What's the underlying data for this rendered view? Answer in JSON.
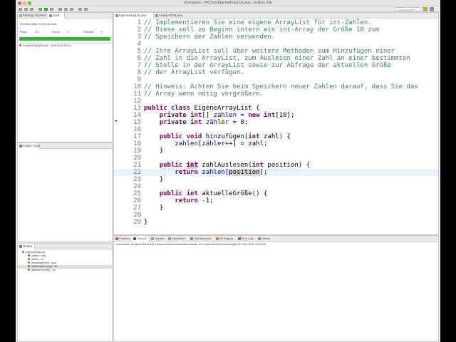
{
  "window": {
    "title": "workspace - PR1/src/EigeneArrayList.java - Eclipse IDE",
    "traffic_lights": [
      "#ee5f58",
      "#f6be4f",
      "#5fc454"
    ]
  },
  "toolbar": {
    "quick_access_placeholder": "Quick Access"
  },
  "left_pane": {
    "tabs": [
      {
        "label": "Package Explorer"
      },
      {
        "label": "JUnit",
        "active": true
      }
    ],
    "status": "Finished after 0.102 seconds",
    "counters": {
      "runs_label": "Runs:",
      "runs_value": "1/1",
      "errors_label": "Errors:",
      "errors_value": "0",
      "failures_label": "Failures:",
      "failures_value": "0"
    },
    "test_row": "ArrayListTest [Runner: JUnit 5] (0.012 s)",
    "bar_color": "#3dae3d"
  },
  "failure_trace": {
    "label": "Failure Trace"
  },
  "outline": {
    "label": "Outline",
    "items": [
      {
        "label": "EigeneArrayList",
        "level": 0
      },
      {
        "label": "zahlen : int[]",
        "level": 1
      },
      {
        "label": "zähler : int",
        "level": 1
      },
      {
        "label": "hinzufügen(int) : void",
        "level": 1
      },
      {
        "label": "zahlAuslesen(int) : int",
        "level": 1,
        "selected": true
      },
      {
        "label": "aktuelleGröße() : int",
        "level": 1
      }
    ]
  },
  "editor": {
    "tabs": [
      {
        "label": "EigeneArrayList.java",
        "active": true
      },
      {
        "label": "ArrayListTest.java"
      }
    ],
    "lines": [
      {
        "n": "1",
        "t": "// Implementieren Sie eine eigene ArrayList für int-Zahlen."
      },
      {
        "n": "2",
        "t": "// Diese soll zu Beginn intern ein int-Array der Größe 10 zum"
      },
      {
        "n": "3",
        "t": "// Speichern der Zahlen verwenden."
      },
      {
        "n": "4",
        "t": ""
      },
      {
        "n": "5",
        "t": "// Ihre ArrayList soll über weitere Methoden zum Hinzufügen einer"
      },
      {
        "n": "6",
        "t": "// Zahl in die ArrayList, zum Auslesen einer Zahl an einer bestimmten"
      },
      {
        "n": "7",
        "t": "// Stelle in der ArrayList sowie zur Abfrage der aktuellen Größe"
      },
      {
        "n": "8",
        "t": "// der ArrayList verfügen."
      },
      {
        "n": "9",
        "t": ""
      },
      {
        "n": "10",
        "t": "// Hinweis: Achten Sie beim Speichern neuer Zahlen darauf, dass Sie das"
      },
      {
        "n": "11",
        "t": "// Array wenn nötig vergrößern."
      },
      {
        "n": "12",
        "t": ""
      },
      {
        "n": "13",
        "t": "public class EigeneArrayList {"
      },
      {
        "n": "14",
        "t": "    private int[] zahlen = new int[10];"
      },
      {
        "n": "15",
        "t": "    private int zähler = 0;"
      },
      {
        "n": "16",
        "t": ""
      },
      {
        "n": "17",
        "t": "    public void hinzufügen(int zahl) {"
      },
      {
        "n": "18",
        "t": "        zahlen[zähler++] = zahl;"
      },
      {
        "n": "19",
        "t": "    }"
      },
      {
        "n": "20",
        "t": ""
      },
      {
        "n": "21",
        "t": "    public int zahlAuslesen(int position) {"
      },
      {
        "n": "22",
        "t": "        return zahlen[position];"
      },
      {
        "n": "23",
        "t": "    }"
      },
      {
        "n": "24",
        "t": ""
      },
      {
        "n": "25",
        "t": "    public int aktuelleGröße() {"
      },
      {
        "n": "26",
        "t": "        return -1;"
      },
      {
        "n": "27",
        "t": "    }"
      },
      {
        "n": "28",
        "t": ""
      },
      {
        "n": "29",
        "t": "}"
      }
    ]
  },
  "console": {
    "tabs": [
      {
        "label": "Problems"
      },
      {
        "label": "Console",
        "active": true
      },
      {
        "label": "Javadoc"
      },
      {
        "label": "Declaration"
      },
      {
        "label": "Call Hierarchy"
      },
      {
        "label": "Git Staging"
      },
      {
        "label": "Error Log"
      },
      {
        "label": "History"
      }
    ],
    "output": "<terminated> ArrayListTest [JUnit] /Library/Java/JavaVirtualMachines/jdk-10.0.2.jdk/Contents/Home/bin/java (21 Dec 2018, 13:25:49)"
  }
}
